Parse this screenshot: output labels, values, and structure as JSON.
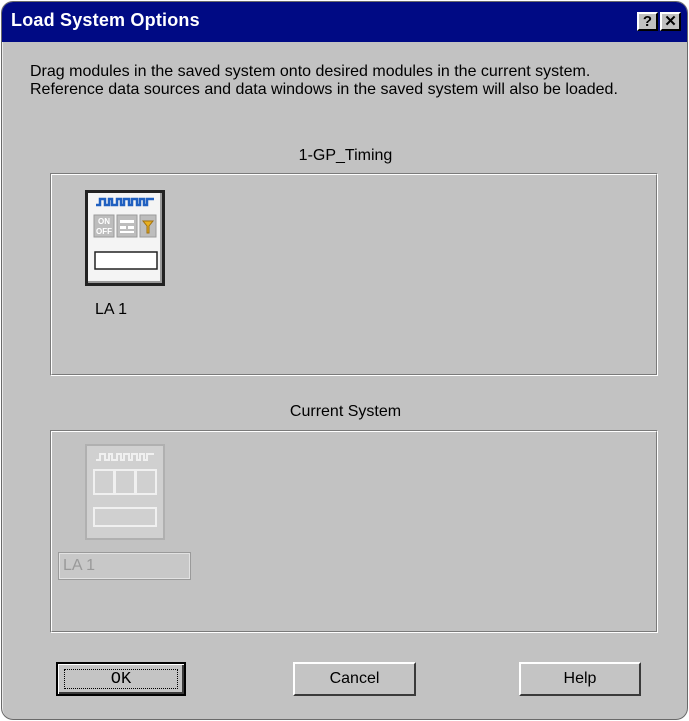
{
  "window": {
    "title": "Load System Options",
    "help_button": "?",
    "close_button": "✕"
  },
  "instructions": "Drag modules in the saved system onto desired modules in the current system. Reference data sources and data windows in the saved system will also be loaded.",
  "saved_system": {
    "label": "1-GP_Timing",
    "modules": [
      {
        "name": "LA 1",
        "icon": "logic-analyzer-module-icon"
      }
    ]
  },
  "current_system": {
    "label": "Current System",
    "modules": [
      {
        "name_value": "LA 1",
        "icon": "logic-analyzer-module-icon"
      }
    ]
  },
  "buttons": {
    "ok": "OK",
    "cancel": "Cancel",
    "help": "Help"
  },
  "colors": {
    "titlebar": "#000a84",
    "dialog_face": "#c2c2c2",
    "waveform_accent": "#2060c0",
    "trigger_accent": "#e8b020"
  }
}
